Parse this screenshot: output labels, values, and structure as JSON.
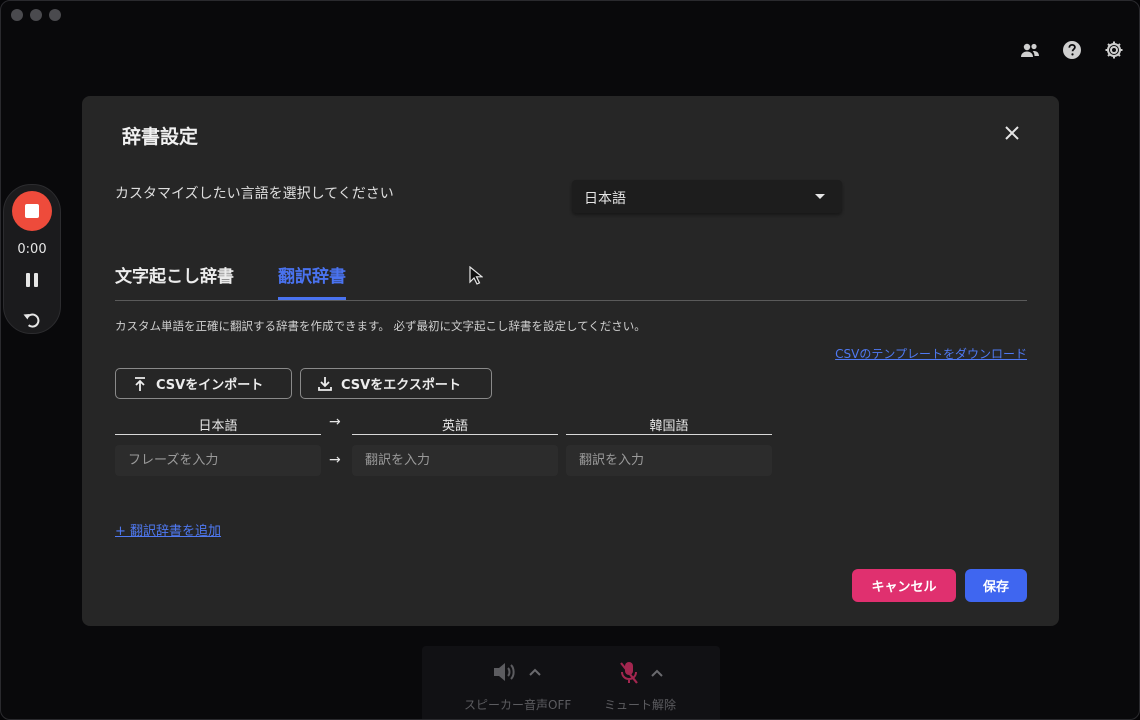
{
  "modal": {
    "title": "辞書設定",
    "language_label": "カスタマイズしたい言語を選択してください",
    "language_selected": "日本語",
    "tabs": [
      {
        "label": "文字起こし辞書",
        "active": false
      },
      {
        "label": "翻訳辞書",
        "active": true
      }
    ],
    "description": "カスタム単語を正確に翻訳する辞書を作成できます。 必ず最初に文字起こし辞書を設定してください。",
    "template_link": "CSVのテンプレートをダウンロード",
    "import_button": "CSVをインポート",
    "export_button": "CSVをエクスポート",
    "columns": [
      "日本語",
      "英語",
      "韓国語"
    ],
    "arrow": "→",
    "placeholders": {
      "source": "フレーズを入力",
      "target1": "翻訳を入力",
      "target2": "翻訳を入力"
    },
    "add_link": "+ 翻訳辞書を追加",
    "cancel_button": "キャンセル",
    "save_button": "保存"
  },
  "recorder": {
    "time": "0:00"
  },
  "bottom_bar": {
    "speaker_label": "スピーカー音声OFF",
    "mute_label": "ミュート解除"
  },
  "colors": {
    "accent": "#4a73f0",
    "cancel": "#e0306f",
    "save": "#3f66f0",
    "record": "#ee4b3b",
    "mic_muted": "#e0306f"
  },
  "icons": [
    "people-icon",
    "help-icon",
    "gear-icon",
    "close-icon",
    "upload-icon",
    "download-icon",
    "speaker-icon",
    "mic-muted-icon",
    "chevron-up-icon",
    "stop-icon",
    "pause-icon",
    "undo-icon"
  ]
}
